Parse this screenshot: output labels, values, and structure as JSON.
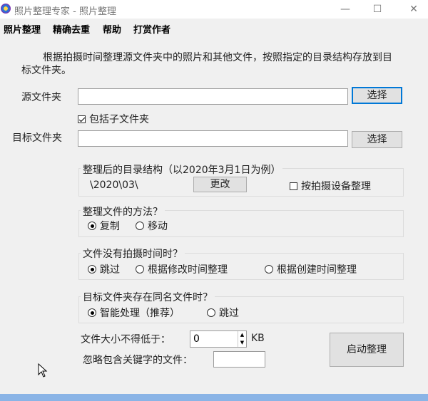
{
  "window": {
    "title": "照片整理专家 - 照片整理",
    "minimize": "—",
    "maximize": "☐",
    "close": "✕"
  },
  "menu": [
    "照片整理",
    "精确去重",
    "帮助",
    "打赏作者"
  ],
  "description": "根据拍摄时间整理源文件夹中的照片和其他文件，按照指定的目录结构存放到目标文件夹。",
  "source": {
    "label": "源文件夹",
    "value": "",
    "button": "选择"
  },
  "include_subfolders": {
    "label": "包括子文件夹",
    "checked": true
  },
  "target": {
    "label": "目标文件夹",
    "value": "",
    "button": "选择"
  },
  "structure": {
    "title": "整理后的目录结构（以2020年3月1日为例）",
    "example": "\\2020\\03\\",
    "change_button": "更改",
    "by_device_label": "按拍摄设备整理",
    "by_device_checked": false
  },
  "method": {
    "title": "整理文件的方法？",
    "options": [
      "复制",
      "移动"
    ],
    "selected": 0
  },
  "no_time": {
    "title": "文件没有拍摄时间时？",
    "options": [
      "跳过",
      "根据修改时间整理",
      "根据创建时间整理"
    ],
    "selected": 0
  },
  "conflict": {
    "title": "目标文件夹存在同名文件时？",
    "options": [
      "智能处理（推荐）",
      "跳过"
    ],
    "selected": 0
  },
  "min_size": {
    "label": "文件大小不得低于：",
    "value": "0",
    "unit": "KB"
  },
  "ignore_keyword": {
    "label": "忽略包含关键字的文件：",
    "value": ""
  },
  "start_button": "启动整理"
}
